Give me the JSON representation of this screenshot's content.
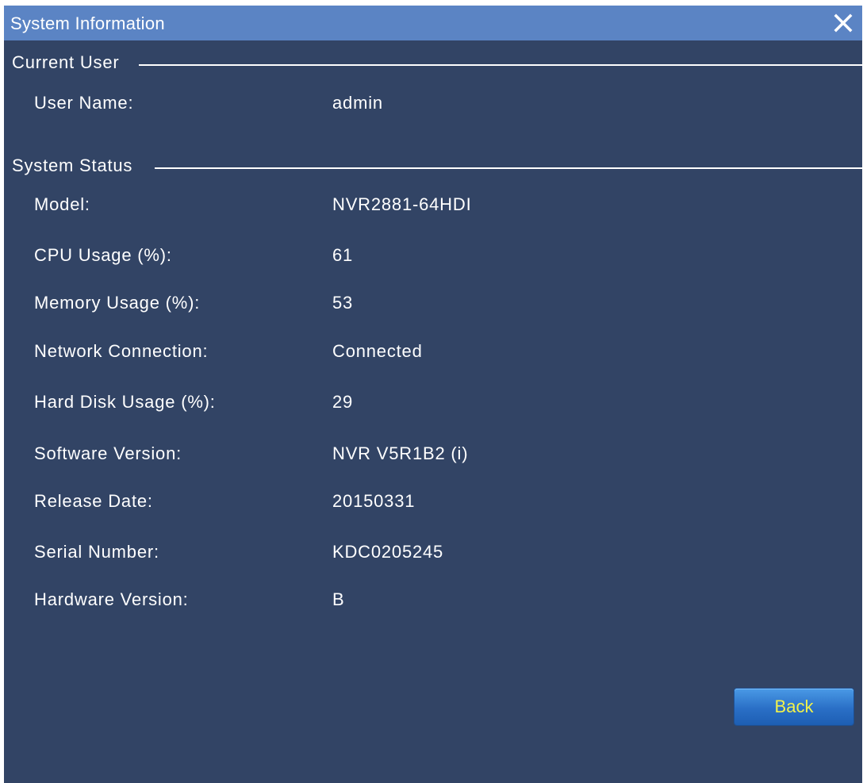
{
  "window": {
    "title": "System Information",
    "close_icon": "close-icon"
  },
  "current_user": {
    "section_label": "Current User",
    "user_name_label": "User Name:",
    "user_name_value": "admin"
  },
  "system_status": {
    "section_label": "System Status",
    "rows": [
      {
        "label": "Model:",
        "value": "NVR2881-64HDI"
      },
      {
        "label": "CPU Usage (%):",
        "value": "61"
      },
      {
        "label": "Memory Usage (%):",
        "value": "53"
      },
      {
        "label": "Network Connection:",
        "value": "Connected"
      },
      {
        "label": "Hard Disk Usage (%):",
        "value": "29"
      },
      {
        "label": "Software Version:",
        "value": "NVR V5R1B2 (i)"
      },
      {
        "label": "Release Date:",
        "value": "20150331"
      },
      {
        "label": "Serial Number:",
        "value": "KDC0205245"
      },
      {
        "label": "Hardware Version:",
        "value": "B"
      }
    ]
  },
  "footer": {
    "back_label": "Back"
  },
  "colors": {
    "titlebar": "#5b84c4",
    "panel": "#324465",
    "button_text": "#f2f24a"
  }
}
